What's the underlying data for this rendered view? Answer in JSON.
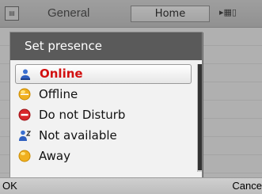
{
  "background": {
    "app_title": "General",
    "tab_label": "Home"
  },
  "dialog": {
    "title": "Set presence",
    "options": [
      {
        "label": "Online",
        "icon": "person-icon",
        "selected": true
      },
      {
        "label": "Offline",
        "icon": "yellow-circle-icon",
        "selected": false
      },
      {
        "label": "Do not Disturb",
        "icon": "red-no-entry-icon",
        "selected": false
      },
      {
        "label": "Not available",
        "icon": "person-unavailable-icon",
        "selected": false
      },
      {
        "label": "Away",
        "icon": "yellow-circle-icon",
        "selected": false
      }
    ]
  },
  "softkeys": {
    "left": "OK",
    "right": "Cance"
  },
  "colors": {
    "selected_text": "#d21010",
    "dialog_title_bg": "#5a5a5a"
  }
}
